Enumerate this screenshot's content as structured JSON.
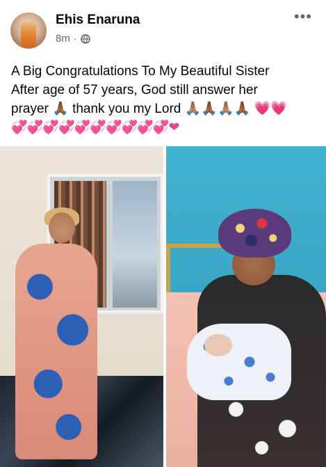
{
  "post": {
    "author": "Ehis Enaruna",
    "time": "8m",
    "separator": "·",
    "privacy_icon": "globe-icon",
    "more_icon": "more-options-icon",
    "more_label": "•••",
    "text_line1": "A Big Congratulations To My Beautiful Sister",
    "text_line2": "After age of 57 years, God still answer her",
    "text_line3_a": "prayer 🙏🏾 thank you my Lord 🙏🏽🙏🏾🙏🏽🙏🏾 ",
    "text_line3_b": "💗💗",
    "text_line4": "💞💞💞💞💞💞💞💞💞💞❤"
  },
  "colors": {
    "text": "#050505",
    "meta": "#65676b",
    "heart_pink": "#e84393"
  }
}
